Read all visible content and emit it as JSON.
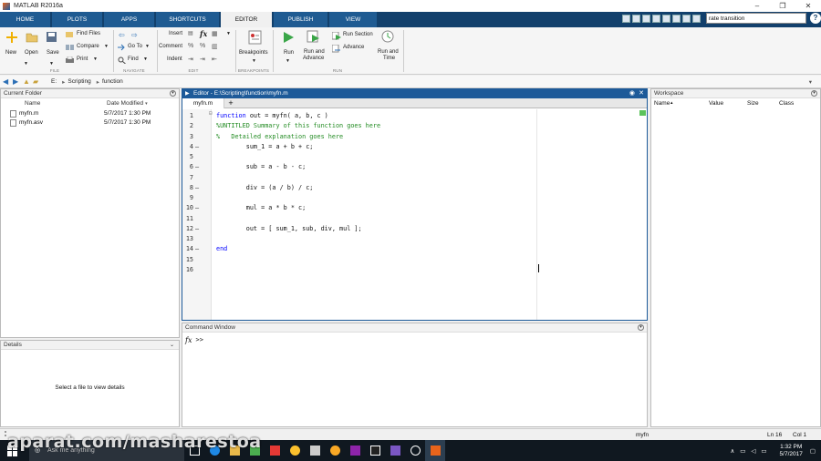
{
  "window": {
    "title": "MATLAB R2016a",
    "controls": [
      "–",
      "❐",
      "✕"
    ]
  },
  "ribbon_tabs": [
    {
      "label": "HOME",
      "active": false
    },
    {
      "label": "PLOTS",
      "active": false
    },
    {
      "label": "APPS",
      "active": false
    },
    {
      "label": "SHORTCUTS",
      "active": false
    },
    {
      "label": "EDITOR",
      "active": true
    },
    {
      "label": "PUBLISH",
      "active": false
    },
    {
      "label": "VIEW",
      "active": false
    }
  ],
  "search": {
    "value": "rate transition"
  },
  "help_icon": "?",
  "ribbon": {
    "file": {
      "group": "FILE",
      "new": "New",
      "open": "Open",
      "save": "Save",
      "find_files": "Find Files",
      "compare": "Compare",
      "print": "Print"
    },
    "navigate": {
      "group": "NAVIGATE",
      "go_to": "Go To",
      "find": "Find"
    },
    "edit": {
      "group": "EDIT",
      "insert": "Insert",
      "comment": "Comment",
      "indent": "Indent",
      "fx": "fx"
    },
    "breakpoints": {
      "group": "BREAKPOINTS",
      "label": "Breakpoints"
    },
    "run": {
      "group": "RUN",
      "run": "Run",
      "run_advance_1": "Run and",
      "run_advance_2": "Advance",
      "run_section": "Run Section",
      "advance": "Advance",
      "run_time_1": "Run and",
      "run_time_2": "Time"
    }
  },
  "address": {
    "parts": [
      "E:",
      "Scripting",
      "function"
    ]
  },
  "current_folder": {
    "title": "Current Folder",
    "col_name": "Name",
    "col_date": "Date Modified",
    "files": [
      {
        "name": "myfn.m",
        "date": "5/7/2017 1:30 PM"
      },
      {
        "name": "myfn.asv",
        "date": "5/7/2017 1:30 PM"
      }
    ]
  },
  "details": {
    "title": "Details",
    "message": "Select a file to view details"
  },
  "editor": {
    "title": "Editor - E:\\Scripting\\function\\myfn.m",
    "tab": "myfn.m",
    "plus": "+",
    "lines": [
      {
        "n": "1",
        "dash": "",
        "kw": "function",
        "text": " out = myfn( a, b, c )",
        "type": "kw"
      },
      {
        "n": "2",
        "dash": "",
        "kw": "",
        "text": "%UNTITLED Summary of this function goes here",
        "type": "cm"
      },
      {
        "n": "3",
        "dash": "",
        "kw": "",
        "text": "%   Detailed explanation goes here",
        "type": "cm"
      },
      {
        "n": "4",
        "dash": "–",
        "kw": "",
        "text": "        sum_1 = a + b + c;",
        "type": "plain"
      },
      {
        "n": "5",
        "dash": "",
        "kw": "",
        "text": "",
        "type": "plain"
      },
      {
        "n": "6",
        "dash": "–",
        "kw": "",
        "text": "        sub = a - b - c;",
        "type": "plain"
      },
      {
        "n": "7",
        "dash": "",
        "kw": "",
        "text": "",
        "type": "plain"
      },
      {
        "n": "8",
        "dash": "–",
        "kw": "",
        "text": "        div = (a / b) / c;",
        "type": "plain"
      },
      {
        "n": "9",
        "dash": "",
        "kw": "",
        "text": "",
        "type": "plain"
      },
      {
        "n": "10",
        "dash": "–",
        "kw": "",
        "text": "        mul = a * b * c;",
        "type": "plain"
      },
      {
        "n": "11",
        "dash": "",
        "kw": "",
        "text": "",
        "type": "plain"
      },
      {
        "n": "12",
        "dash": "–",
        "kw": "",
        "text": "        out = [ sum_1, sub, div, mul ];",
        "type": "plain"
      },
      {
        "n": "13",
        "dash": "",
        "kw": "",
        "text": "",
        "type": "plain"
      },
      {
        "n": "14",
        "dash": "–",
        "kw": "end",
        "text": "",
        "type": "kw"
      },
      {
        "n": "15",
        "dash": "",
        "kw": "",
        "text": "",
        "type": "plain"
      },
      {
        "n": "16",
        "dash": "",
        "kw": "",
        "text": "",
        "type": "plain"
      }
    ]
  },
  "command_window": {
    "title": "Command Window",
    "fx": "fx",
    "prompt": ">>"
  },
  "workspace": {
    "title": "Workspace",
    "cols": [
      "Name",
      "Value",
      "Size",
      "Class"
    ]
  },
  "status": {
    "function": "myfn",
    "ln": "Ln 16",
    "col": "Col 1"
  },
  "taskbar": {
    "search_placeholder": "Ask me anything",
    "time": "1:32 PM",
    "date": "5/7/2017"
  },
  "watermark": "aparat.com/masharestoa",
  "colors": {
    "ribbon_bg": "#12406c",
    "editor_header": "#1d5a99",
    "keyword": "#0000ff",
    "comment": "#228b22"
  }
}
